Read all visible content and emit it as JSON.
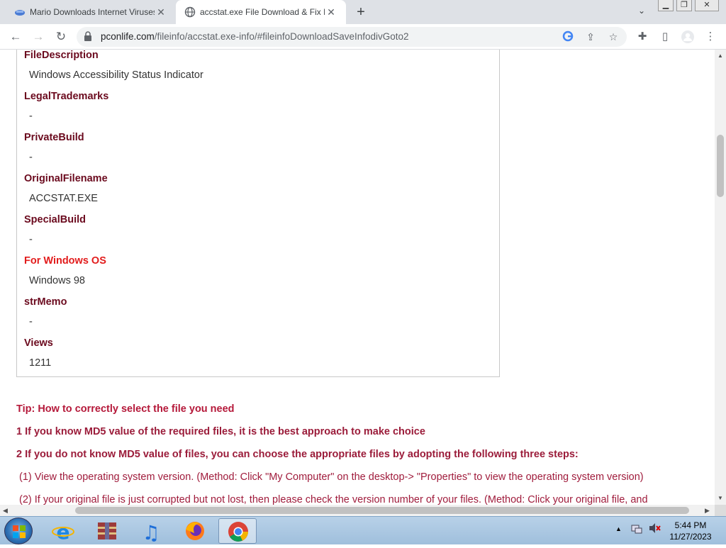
{
  "browser": {
    "tabs": [
      {
        "title": "Mario Downloads Internet Viruses",
        "active": false,
        "icon": "download-site-icon"
      },
      {
        "title": "accstat.exe File Download & Fix For",
        "active": true,
        "icon": "globe-icon"
      }
    ],
    "url_host": "pconlife.com",
    "url_path": "/fileinfo/accstat.exe-info/#fileinfoDownloadSaveInfodivGoto2",
    "new_tab_symbol": "+",
    "win_controls": [
      "minimize",
      "restore",
      "close"
    ]
  },
  "fields": [
    {
      "label": "FileDescription",
      "value": "Windows Accessibility Status Indicator",
      "highlight": false
    },
    {
      "label": "LegalTrademarks",
      "value": "-",
      "highlight": false
    },
    {
      "label": "PrivateBuild",
      "value": "-",
      "highlight": false
    },
    {
      "label": "OriginalFilename",
      "value": "ACCSTAT.EXE",
      "highlight": false
    },
    {
      "label": "SpecialBuild",
      "value": "-",
      "highlight": false
    },
    {
      "label": "For Windows OS",
      "value": "Windows 98",
      "highlight": true
    },
    {
      "label": "strMemo",
      "value": "-",
      "highlight": false
    },
    {
      "label": "Views",
      "value": "1211",
      "highlight": false
    }
  ],
  "tips": {
    "title": "Tip: How to correctly select the file you need",
    "step1": "1 If you know MD5 value of the required files, it is the best approach to make choice",
    "step2": "2 If you do not know MD5 value of files, you can choose the appropriate files by adopting the following three steps:",
    "note1": "(1) View the operating system version. (Method: Click \"My Computer\" on the desktop-> \"Properties\" to view the operating system version)",
    "note2": "(2) If your original file is just corrupted but not lost, then please check the version number of your files. (Method: Click your original file, and"
  },
  "taskbar": {
    "apps": [
      "internet-explorer-icon",
      "archive-app-icon",
      "itunes-icon",
      "firefox-icon",
      "chrome-icon"
    ],
    "active_app": "chrome-icon",
    "time": "5:44 PM",
    "date": "11/27/2023"
  },
  "colors": {
    "label": "#6b0a1e",
    "label_highlight": "#e21c1c",
    "tip": "#b5193a"
  }
}
